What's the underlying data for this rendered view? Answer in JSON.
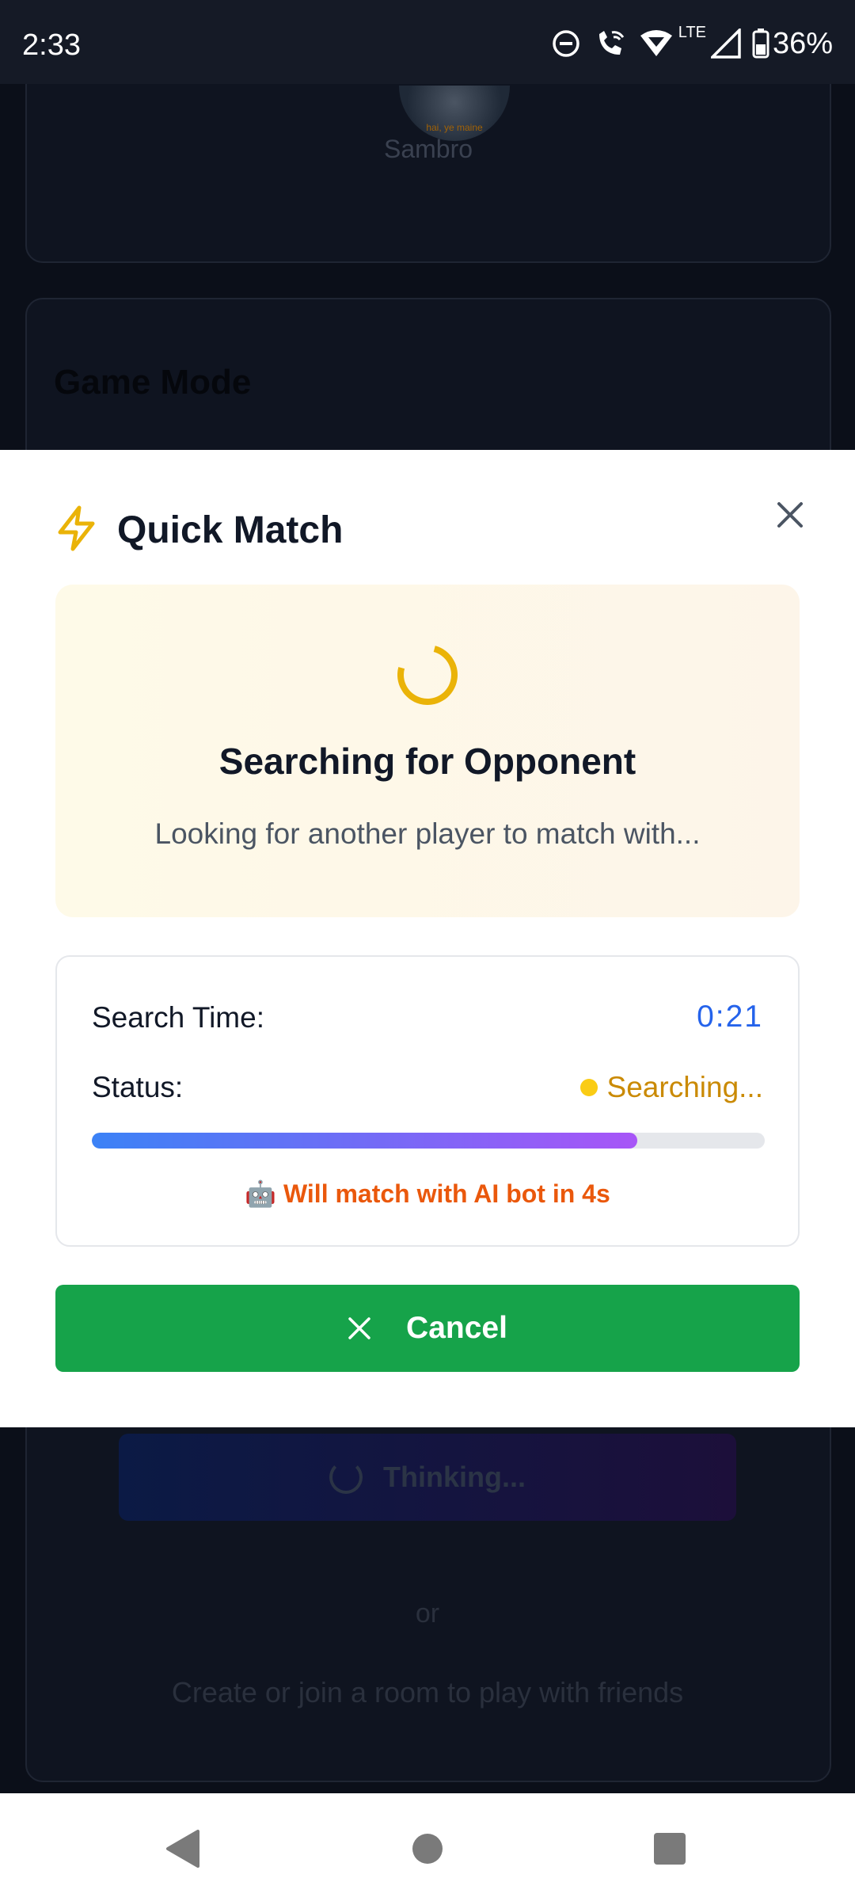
{
  "status_bar": {
    "time": "2:33",
    "network": "LTE",
    "battery": "36%"
  },
  "background": {
    "avatar_caption": "hai, ye maine",
    "player_name": "Sambro",
    "game_mode_title": "Game Mode",
    "thinking_label": "Thinking...",
    "or_label": "or",
    "room_text": "Create or join a room to play with friends"
  },
  "modal": {
    "title": "Quick Match",
    "search_heading": "Searching for Opponent",
    "search_subtitle": "Looking for another player to match with...",
    "search_time_label": "Search Time:",
    "search_time_value": "0:21",
    "status_label": "Status:",
    "status_value": "Searching...",
    "progress_percent": 81,
    "ai_note": "🤖 Will match with AI bot in 4s",
    "cancel_label": "Cancel"
  },
  "colors": {
    "accent_yellow": "#eab308",
    "time_blue": "#2563eb",
    "status_amber": "#ca8a04",
    "ai_orange": "#ea580c",
    "cancel_green": "#16a34a"
  },
  "icons": [
    "do-not-disturb-icon",
    "wifi-call-icon",
    "wifi-icon",
    "cell-signal-icon",
    "battery-icon",
    "bolt-icon",
    "close-icon",
    "spinner-icon",
    "back-icon",
    "home-icon",
    "recents-icon"
  ]
}
